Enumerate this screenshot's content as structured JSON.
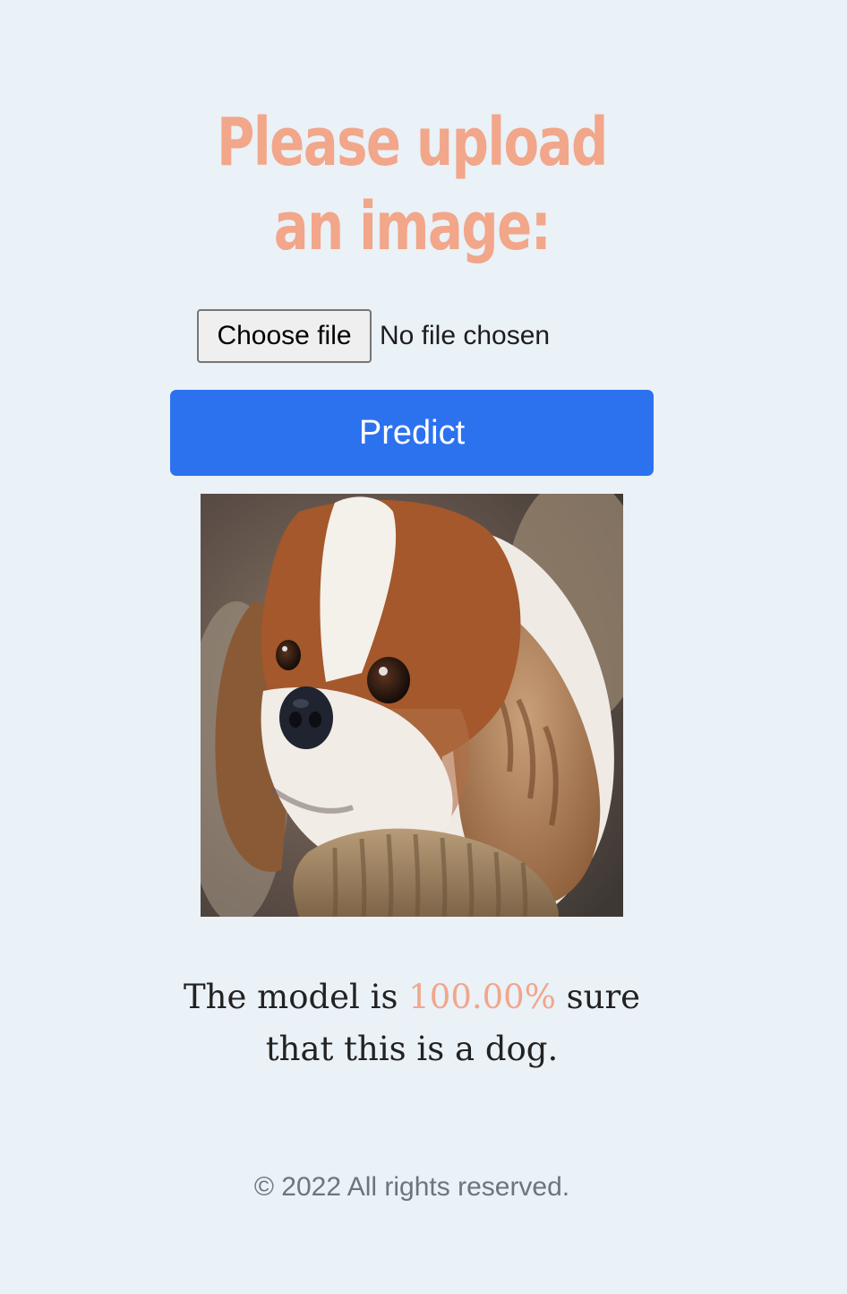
{
  "page": {
    "title": "Please upload an image:",
    "background_color": "#eaf1f7",
    "accent_color": "#f2a68a"
  },
  "upload": {
    "choose_label": "Choose file",
    "status_text": "No file chosen"
  },
  "predict": {
    "label": "Predict",
    "color": "#2c72ef"
  },
  "preview": {
    "subject": "dog"
  },
  "result": {
    "prefix": "The model is",
    "confidence": "100.00%",
    "suffix": "sure that this is a dog."
  },
  "footer": {
    "text": "© 2022 All rights reserved."
  }
}
